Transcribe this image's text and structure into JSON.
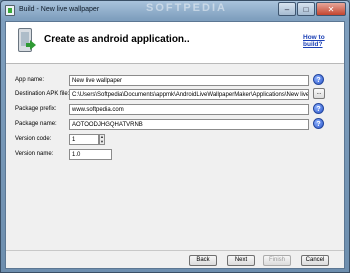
{
  "window": {
    "title": "Build - New live wallpaper",
    "watermark": "SOFTPEDIA"
  },
  "header": {
    "title": "Create as android application..",
    "help_link": "How to build?"
  },
  "form": {
    "app_name": {
      "label": "App name:",
      "value": "New live wallpaper"
    },
    "destination": {
      "label": "Destination APK file:",
      "value": "C:\\Users\\Softpedia\\Documents\\appmk\\AndroidLiveWallpaperMaker\\Applications\\New live wallpa",
      "browse": "..."
    },
    "package_prefix": {
      "label": "Package prefix:",
      "value": "www.softpedia.com"
    },
    "package_name": {
      "label": "Package name:",
      "value": "AOTOODJHGQHATVRNB"
    },
    "version_code": {
      "label": "Version code:",
      "value": "1"
    },
    "version_name": {
      "label": "Version name:",
      "value": "1.0"
    }
  },
  "footer": {
    "back": "Back",
    "next": "Next",
    "finish": "Finish",
    "cancel": "Cancel"
  }
}
